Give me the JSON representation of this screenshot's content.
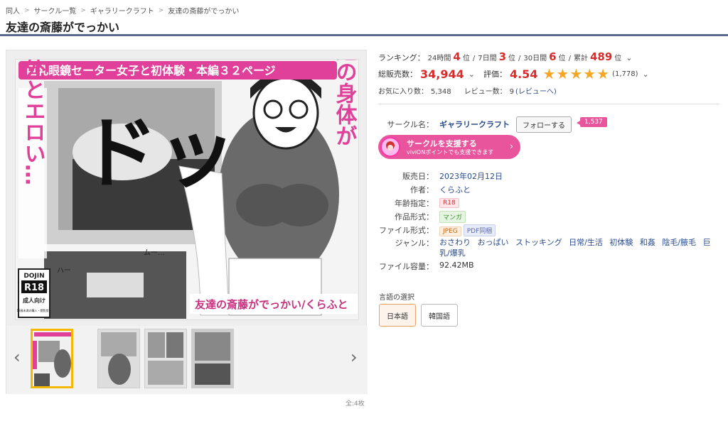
{
  "breadcrumb": {
    "items": [
      "同人",
      "サークル一覧",
      "ギャラリークラフト",
      "友達の斎藤がでっかい"
    ]
  },
  "title": "友達の斎藤がでっかい",
  "ranking": {
    "label": "ランキング：",
    "h24_label": "24時間",
    "h24": "4",
    "unit": "位",
    "d7_label": "7日間",
    "d7": "3",
    "d30_label": "30日間",
    "d30": "6",
    "total_label": "累計",
    "total": "489"
  },
  "sales": {
    "label": "総販売数：",
    "value": "34,944",
    "rating_label": "評価：",
    "rating": "4.54",
    "rating_count": "(1,778)"
  },
  "favorites": {
    "label": "お気に入り数：",
    "value": "5,348",
    "review_label": "レビュー数：",
    "review_value": "9",
    "review_link": "(レビューへ)"
  },
  "circle": {
    "label": "サークル名：",
    "name": "ギャラリークラフト",
    "follow": "フォローする",
    "followers": "1,537"
  },
  "support": {
    "title": "サークルを支援する",
    "subtitle": "viviONポイントでも支援できます"
  },
  "details": {
    "release_label": "販売日：",
    "release": "2023年02月12日",
    "author_label": "作者：",
    "author": "くらふと",
    "age_label": "年齢指定：",
    "age": "R18",
    "format_label": "作品形式：",
    "format": "マンガ",
    "file_label": "ファイル形式：",
    "file_jpeg": "JPEG",
    "file_pdf": "PDF同梱",
    "genre_label": "ジャンル：",
    "genres": [
      "おさわり",
      "おっぱい",
      "ストッキング",
      "日常/生活",
      "初体験",
      "和姦",
      "陰毛/腋毛",
      "巨乳/爆乳"
    ],
    "size_label": "ファイル容量：",
    "size": "92.42MB"
  },
  "language": {
    "label": "言語の選択",
    "ja": "日本語",
    "ko": "韓国語"
  },
  "cover": {
    "banner": "巨乳眼鏡セーター女子と初体験・本編３２ページ",
    "left_text": "意外とエロい…",
    "right_text": "友達の身体が",
    "sfx": "ドッ",
    "bottom_caption": "友達の斎藤がでっかい/くらふと",
    "badge_top": "DOJIN",
    "badge_mid": "R18",
    "badge_sub": "成人向け",
    "badge_small": "18歳未満の購入・閲覧禁止",
    "small_sfx1": "ムー…",
    "small_sfx2": "ハー"
  },
  "gallery_count": "全:4枚"
}
